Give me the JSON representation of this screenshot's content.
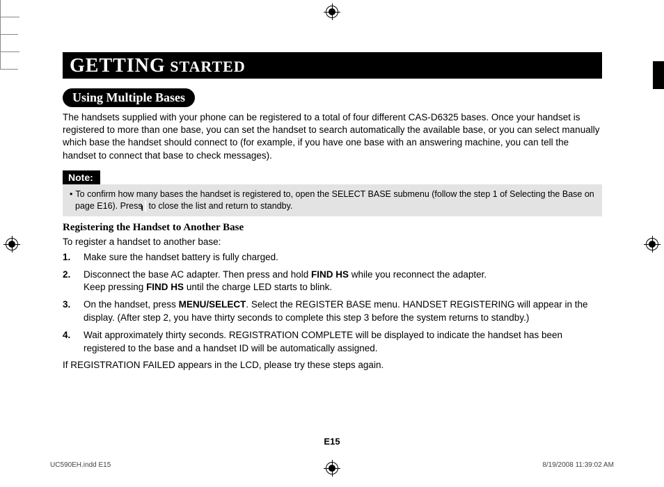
{
  "header": {
    "title_big": "GETTING",
    "title_small": " STARTED"
  },
  "section": {
    "pill": "Using Multiple Bases",
    "intro": "The handsets supplied with your phone can be registered to a total of four different CAS-D6325 bases. Once your handset is registered to more than one base, you can set the handset to search automatically the available base, or you can select manually which base the handset should connect to (for example, if you have one base with an answering machine, you can tell the handset to connect that base to check messages)."
  },
  "note": {
    "label": "Note:",
    "text_before": "To confirm how many bases the handset is registered to, open the SELECT BASE submenu (follow the step 1 of Selecting the Base on page E16). Press ",
    "glyph": "ɿ",
    "text_after": " to close the list and return to standby."
  },
  "subhead": "Registering the Handset to Another Base",
  "lead": "To register a handset to another base:",
  "steps": [
    {
      "parts": [
        {
          "t": "Make sure the handset battery is fully charged."
        }
      ]
    },
    {
      "parts": [
        {
          "t": "Disconnect the base AC adapter. Then press and hold "
        },
        {
          "t": "FIND HS",
          "b": true
        },
        {
          "t": " while you reconnect the adapter."
        },
        {
          "br": true
        },
        {
          "t": "Keep pressing "
        },
        {
          "t": "FIND HS",
          "b": true
        },
        {
          "t": " until the charge LED starts to blink."
        }
      ]
    },
    {
      "parts": [
        {
          "t": "On the handset, press "
        },
        {
          "t": "MENU/SELECT",
          "b": true
        },
        {
          "t": ". Select the REGISTER BASE menu. HANDSET REGISTERING will appear in the display. (After step 2, you have thirty seconds to complete this step 3 before the system returns to standby.)"
        }
      ]
    },
    {
      "parts": [
        {
          "t": "Wait approximately thirty seconds. REGISTRATION COMPLETE will be displayed to indicate the handset has been registered to the base and a handset ID will be automatically assigned."
        }
      ]
    }
  ],
  "after": "If REGISTRATION FAILED appears in the LCD, please try these steps again.",
  "pagenum": "E15",
  "footer": {
    "file": "UC590EH.indd   E15",
    "stamp": "8/19/2008   11:39:02 AM"
  }
}
